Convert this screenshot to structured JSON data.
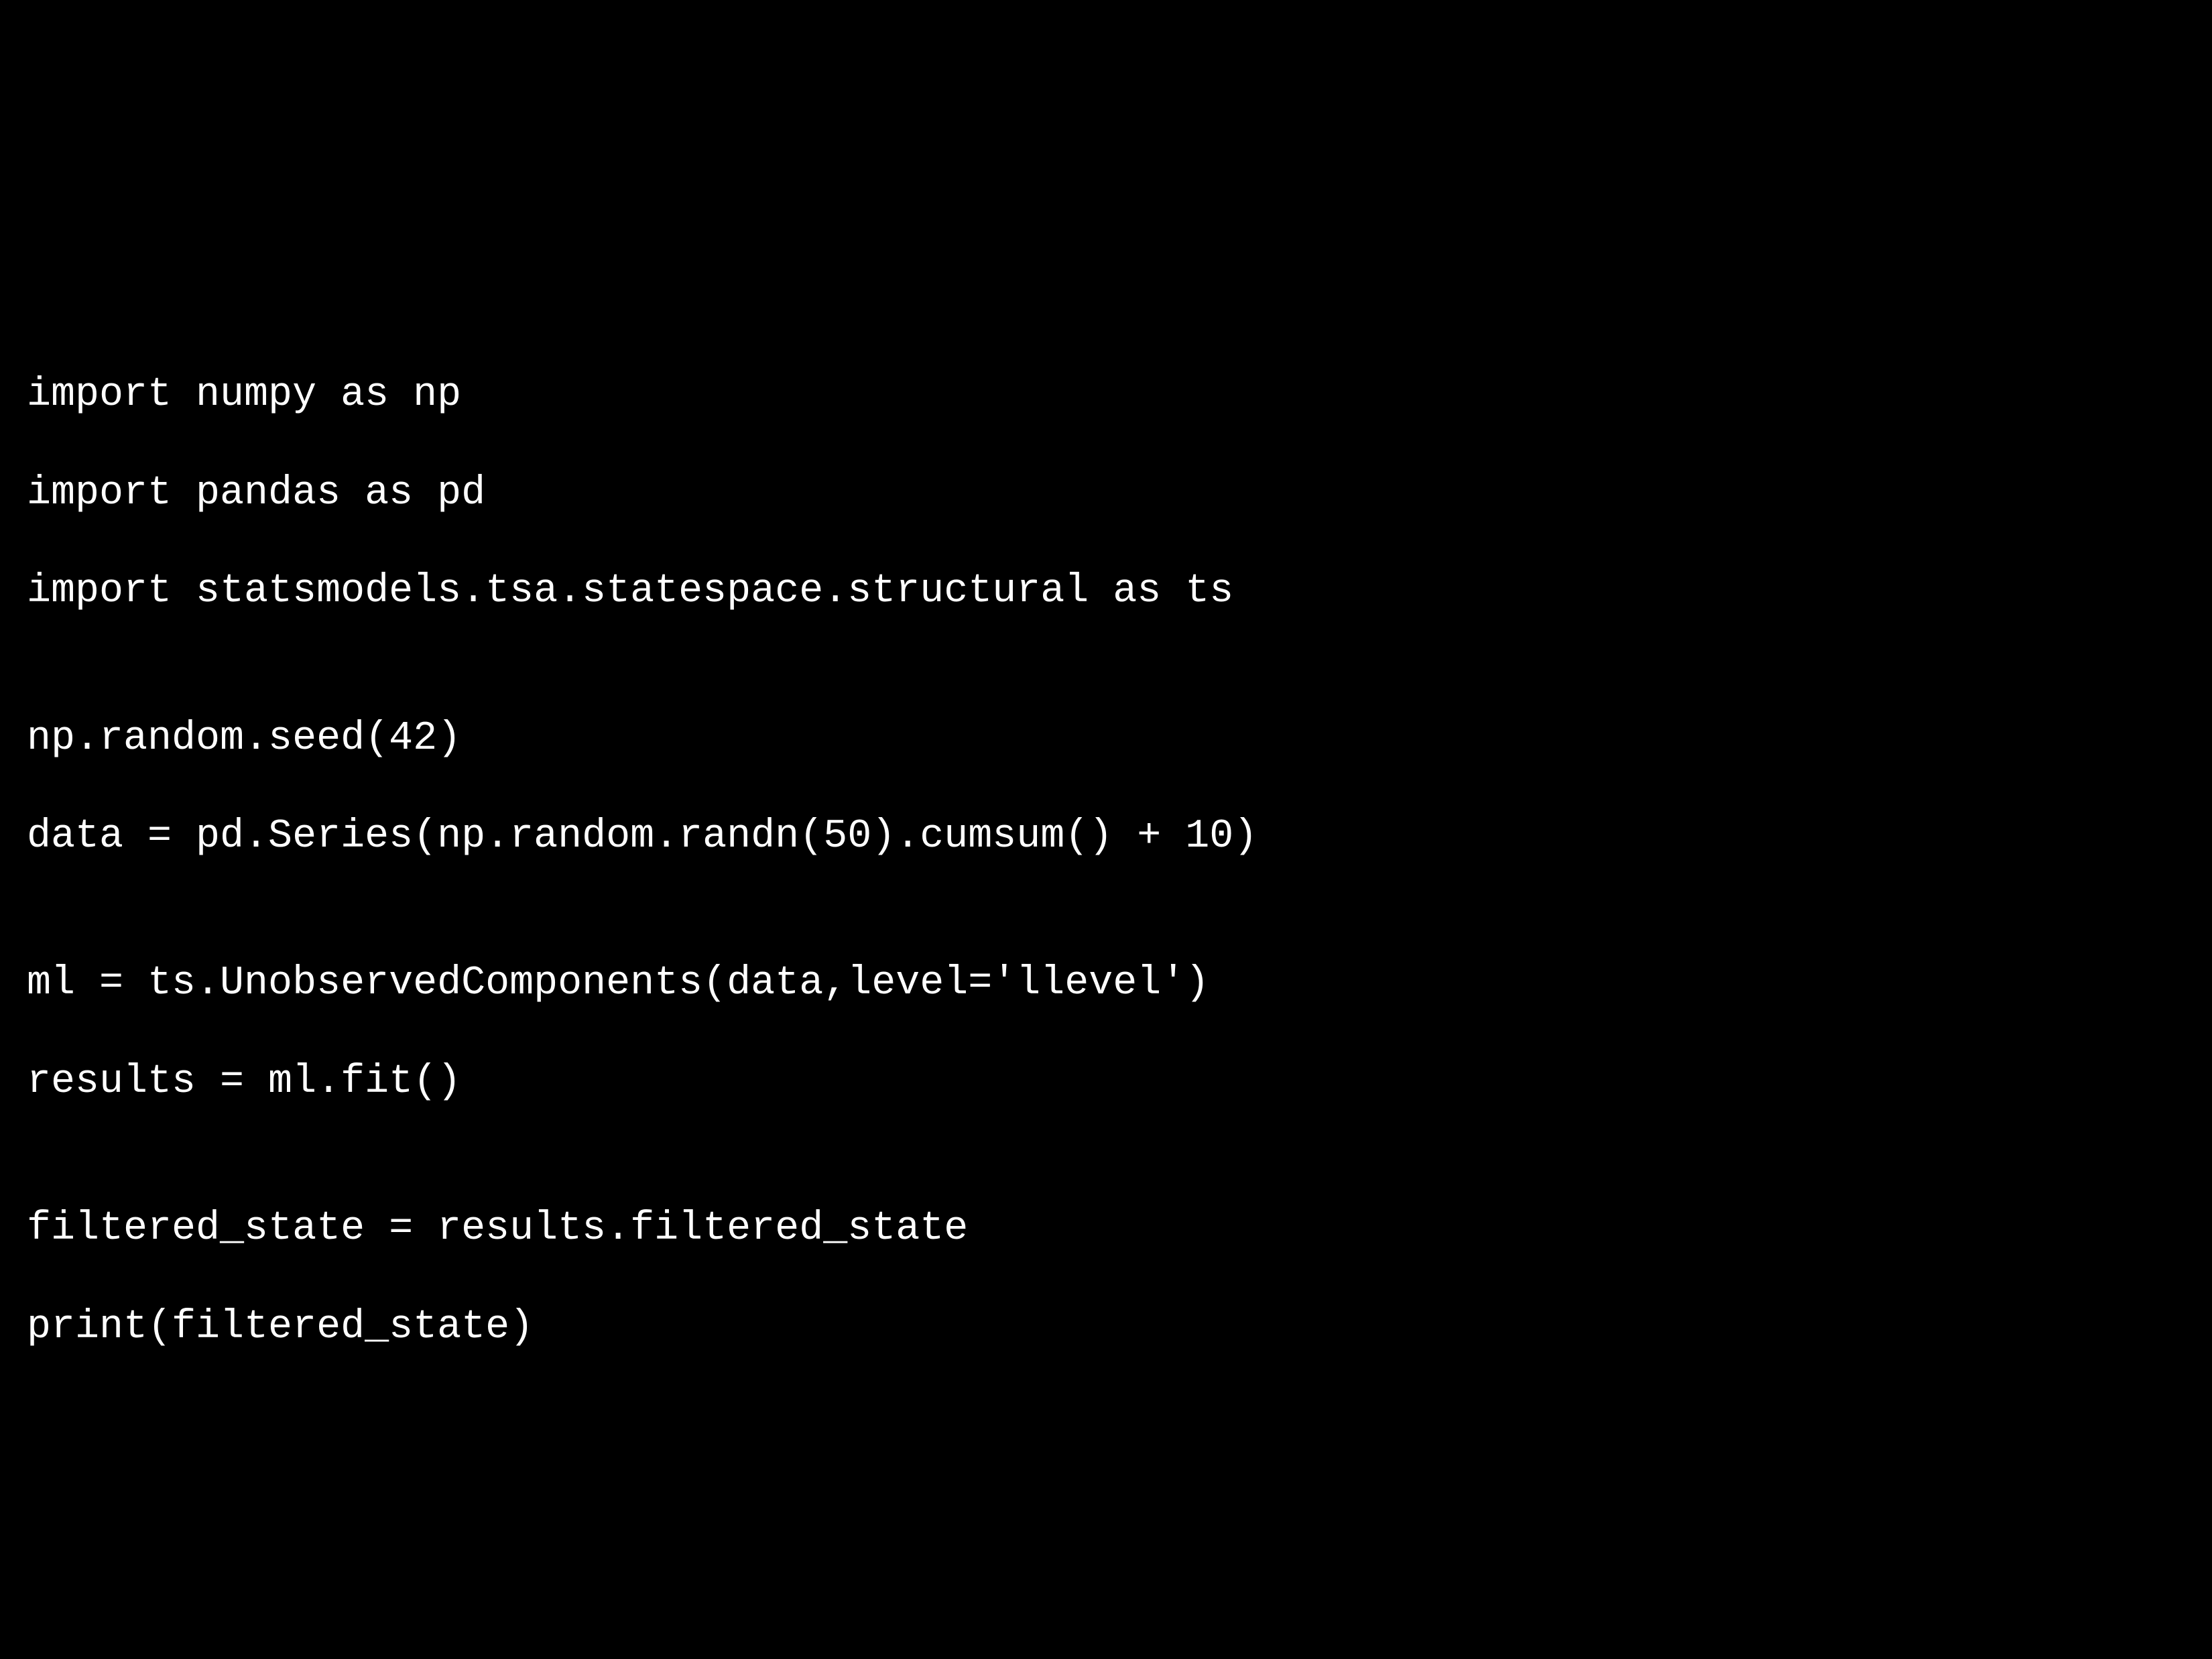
{
  "code": {
    "lines": [
      "import numpy as np",
      "import pandas as pd",
      "import statsmodels.tsa.statespace.structural as ts",
      "",
      "np.random.seed(42)",
      "data = pd.Series(np.random.randn(50).cumsum() + 10)",
      "",
      "ml = ts.UnobservedComponents(data,level='llevel')",
      "results = ml.fit()",
      "",
      "filtered_state = results.filtered_state",
      "print(filtered_state)"
    ]
  },
  "colors": {
    "background": "#000000",
    "text": "#ffffff"
  }
}
